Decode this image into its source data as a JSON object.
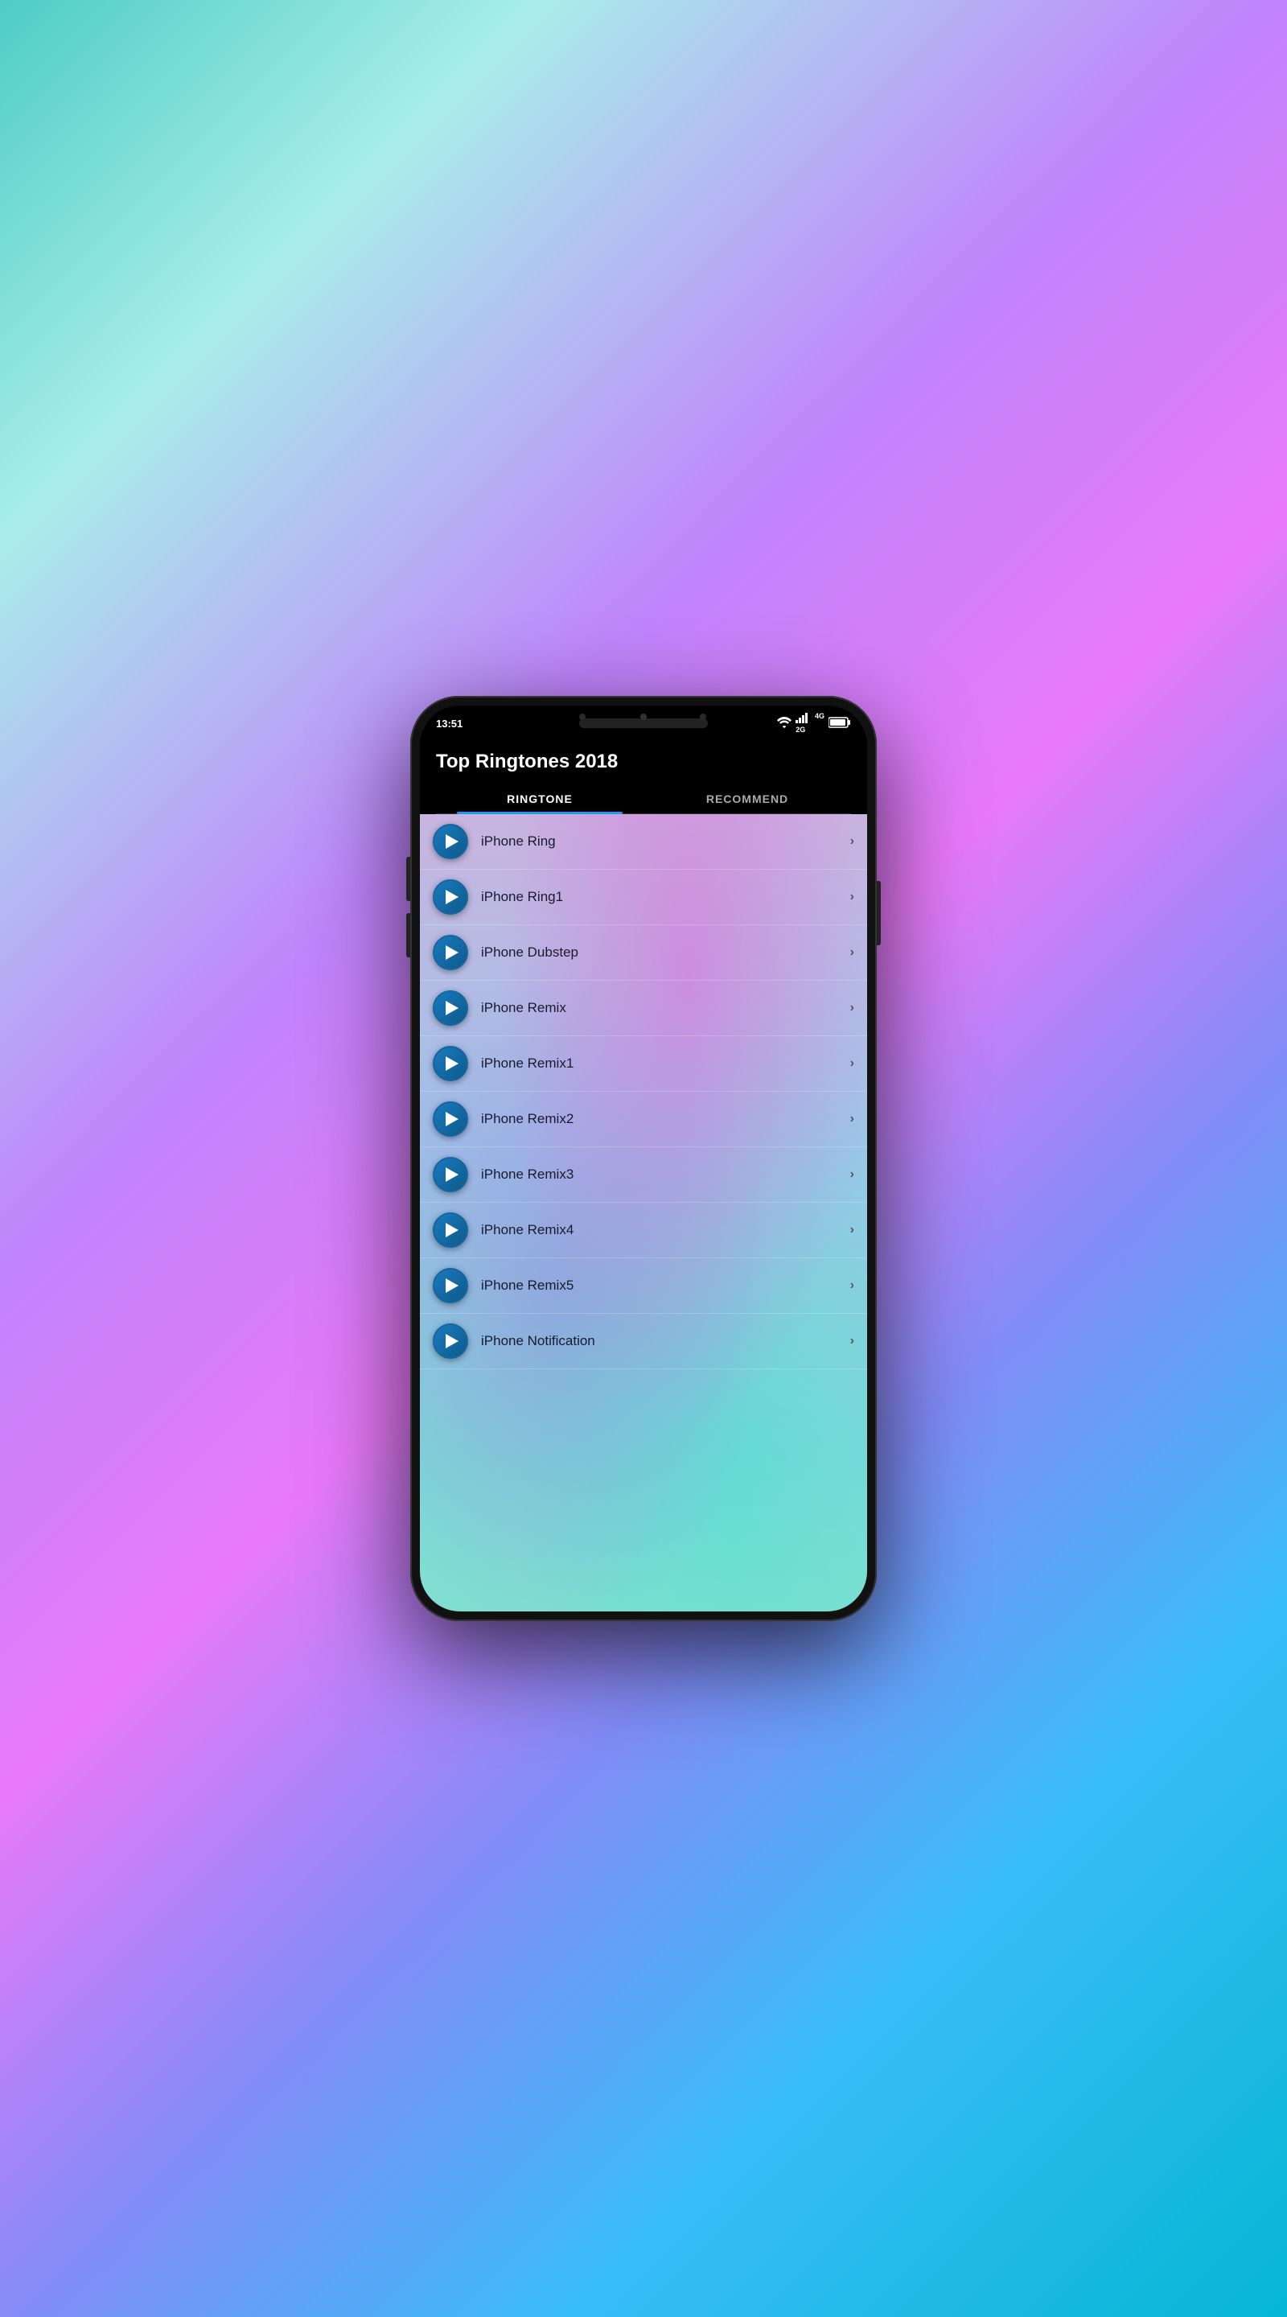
{
  "status": {
    "time": "13:51",
    "wifi": "WiFi",
    "signal": "4G/2G",
    "battery": "Full"
  },
  "header": {
    "title": "Top Ringtones 2018"
  },
  "tabs": [
    {
      "label": "RINGTONE",
      "active": true
    },
    {
      "label": "RECOMMEND",
      "active": false
    }
  ],
  "ringtones": [
    {
      "name": "iPhone Ring"
    },
    {
      "name": "iPhone Ring1"
    },
    {
      "name": "iPhone Dubstep"
    },
    {
      "name": "iPhone Remix"
    },
    {
      "name": "iPhone Remix1"
    },
    {
      "name": "iPhone Remix2"
    },
    {
      "name": "iPhone Remix3"
    },
    {
      "name": "iPhone Remix4"
    },
    {
      "name": "iPhone Remix5"
    },
    {
      "name": "iPhone Notification"
    }
  ]
}
